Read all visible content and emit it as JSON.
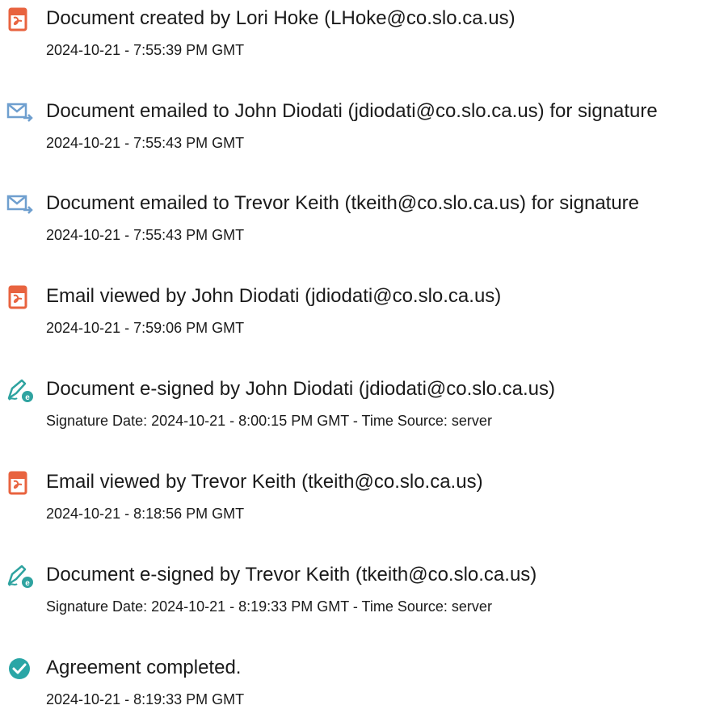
{
  "events": [
    {
      "icon": "document-created-icon",
      "title": "Document created by Lori Hoke (LHoke@co.slo.ca.us)",
      "timestamp": "2024-10-21 - 7:55:39 PM GMT"
    },
    {
      "icon": "email-sent-icon",
      "title": "Document emailed to John Diodati (jdiodati@co.slo.ca.us) for signature",
      "timestamp": "2024-10-21 - 7:55:43 PM GMT"
    },
    {
      "icon": "email-sent-icon",
      "title": "Document emailed to Trevor Keith (tkeith@co.slo.ca.us) for signature",
      "timestamp": "2024-10-21 - 7:55:43 PM GMT"
    },
    {
      "icon": "email-viewed-icon",
      "title": "Email viewed by John Diodati (jdiodati@co.slo.ca.us)",
      "timestamp": "2024-10-21 - 7:59:06 PM GMT"
    },
    {
      "icon": "e-signed-icon",
      "title": "Document e-signed by John Diodati (jdiodati@co.slo.ca.us)",
      "signature_label": "Signature Date: ",
      "signature_date": "2024-10-21 - 8:00:15 PM GMT",
      "separator": " - ",
      "source_label": "Time Source: ",
      "time_source": "server"
    },
    {
      "icon": "email-viewed-icon",
      "title": "Email viewed by Trevor Keith (tkeith@co.slo.ca.us)",
      "timestamp": "2024-10-21 - 8:18:56 PM GMT"
    },
    {
      "icon": "e-signed-icon",
      "title": "Document e-signed by Trevor Keith (tkeith@co.slo.ca.us)",
      "signature_label": "Signature Date: ",
      "signature_date": "2024-10-21 - 8:19:33 PM GMT",
      "separator": " - ",
      "source_label": "Time Source: ",
      "time_source": "server"
    },
    {
      "icon": "agreement-completed-icon",
      "title": "Agreement completed.",
      "timestamp": "2024-10-21 - 8:19:33 PM GMT"
    }
  ],
  "colors": {
    "adobe_red": "#E8633F",
    "email_blue": "#6F9FCF",
    "sign_teal": "#2FA3A0",
    "complete_teal": "#2AA6A6",
    "text": "#1a1a1a"
  }
}
